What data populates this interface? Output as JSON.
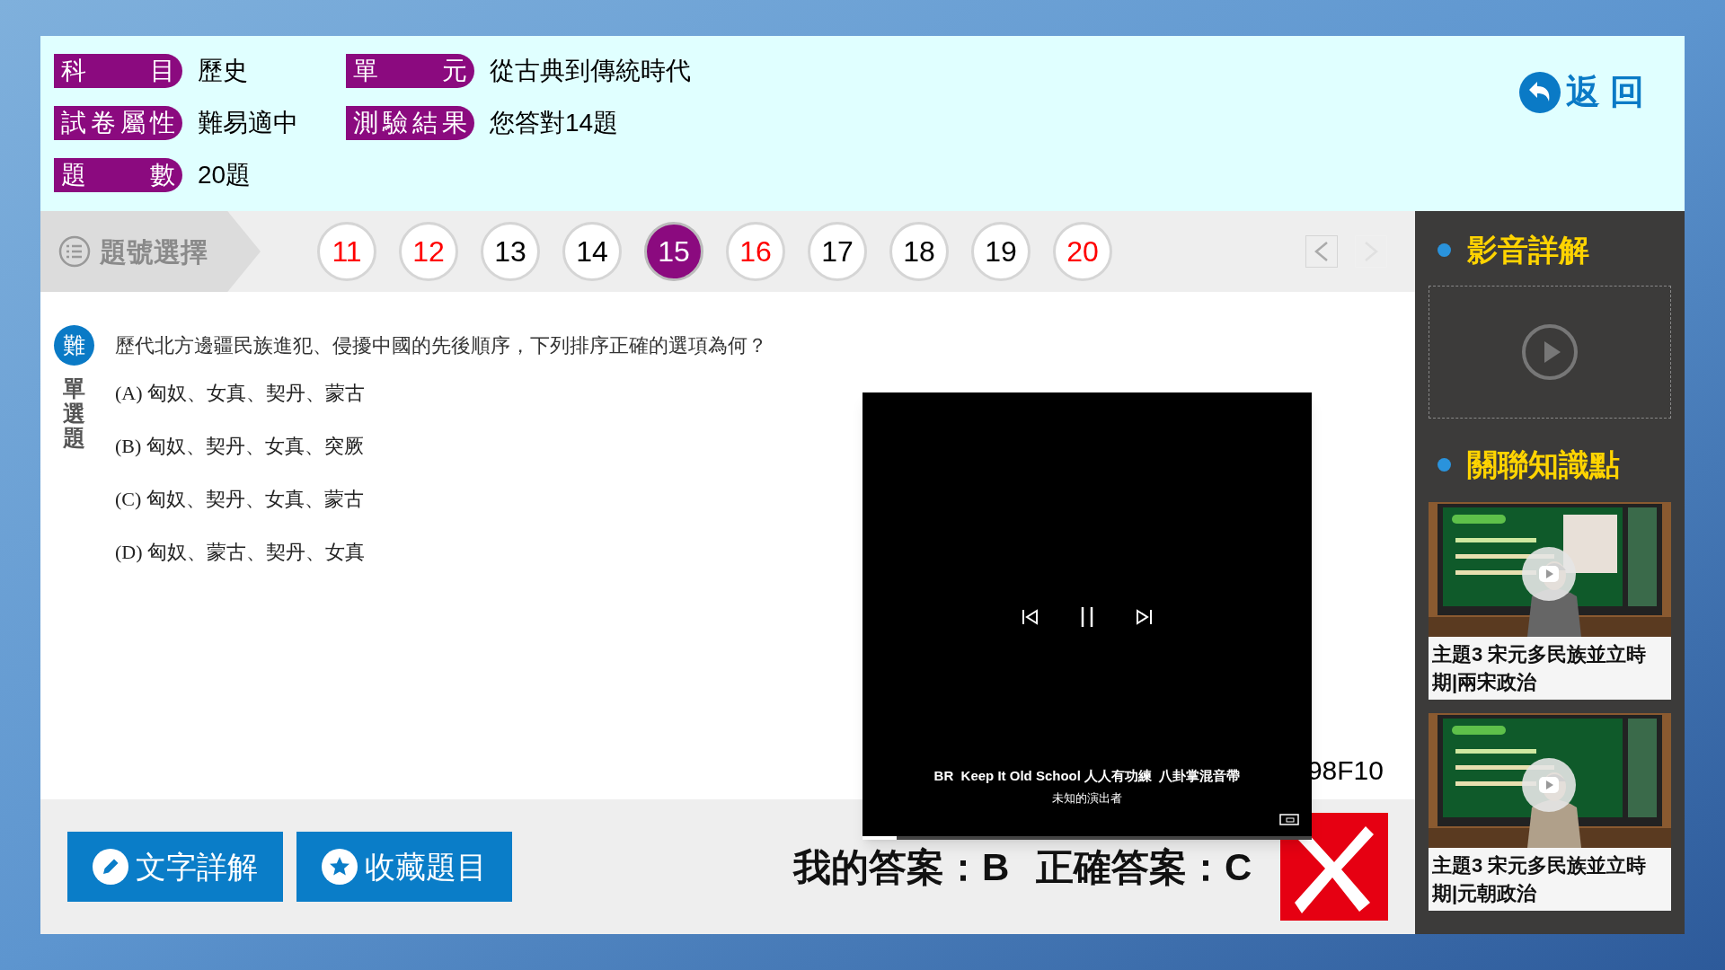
{
  "header": {
    "fields": [
      {
        "label": "科目",
        "value": "歷史"
      },
      {
        "label": "單元",
        "value": "從古典到傳統時代"
      },
      {
        "label": "試卷屬性",
        "value": "難易適中"
      },
      {
        "label": "測驗結果",
        "value": "您答對14題"
      },
      {
        "label": "題數",
        "value": "20題"
      }
    ],
    "back_button": "返 回"
  },
  "question_nav": {
    "title": "題號選擇",
    "numbers": [
      {
        "label": "11",
        "wrong": true,
        "selected": false
      },
      {
        "label": "12",
        "wrong": true,
        "selected": false
      },
      {
        "label": "13",
        "wrong": false,
        "selected": false
      },
      {
        "label": "14",
        "wrong": false,
        "selected": false
      },
      {
        "label": "15",
        "wrong": false,
        "selected": true
      },
      {
        "label": "16",
        "wrong": true,
        "selected": false
      },
      {
        "label": "17",
        "wrong": false,
        "selected": false
      },
      {
        "label": "18",
        "wrong": false,
        "selected": false
      },
      {
        "label": "19",
        "wrong": false,
        "selected": false
      },
      {
        "label": "20",
        "wrong": true,
        "selected": false
      }
    ],
    "prev_disabled": false,
    "next_disabled": true
  },
  "question": {
    "difficulty": "難",
    "type": "單選題",
    "text": "歷代北方邊疆民族進犯、侵擾中國的先後順序，下列排序正確的選項為何？",
    "options": [
      "(A) 匈奴、女真、契丹、蒙古",
      "(B) 匈奴、契丹、女真、突厥",
      "(C) 匈奴、契丹、女真、蒙古",
      "(D) 匈奴、蒙古、契丹、女真"
    ],
    "code": "98F10"
  },
  "video_player": {
    "title": "BR  Keep It Old School 人人有功練  八卦掌混音帶",
    "artist": "未知的演出者",
    "level": 0.075
  },
  "bottom_bar": {
    "buttons": [
      {
        "kind": "text",
        "label": "文字詳解"
      },
      {
        "kind": "bookmark",
        "label": "收藏題目"
      }
    ],
    "my_answer": "我的答案：B",
    "correct_answer": "正確答案：C",
    "correct": false
  },
  "sidebar": {
    "video_title": "影音詳解",
    "related_title": "關聯知識點",
    "related": [
      {
        "title": "主題3 宋元多民族並立時期|兩宋政治"
      },
      {
        "title": "主題3 宋元多民族並立時期|元朝政治"
      }
    ]
  }
}
